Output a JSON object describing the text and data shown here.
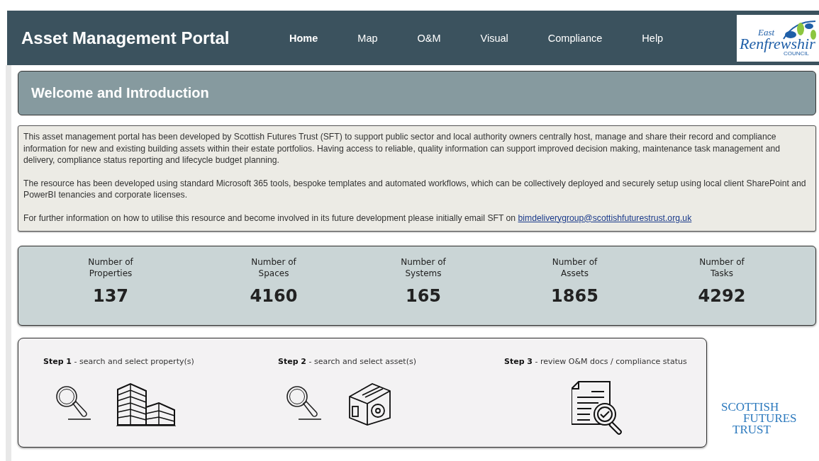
{
  "header": {
    "title": "Asset Management Portal",
    "nav": [
      {
        "label": "Home",
        "selected": true
      },
      {
        "label": "Map",
        "selected": false
      },
      {
        "label": "O&M",
        "selected": false
      },
      {
        "label": "Visual",
        "selected": false
      },
      {
        "label": "Compliance",
        "selected": false
      },
      {
        "label": "Help",
        "selected": false
      }
    ],
    "council_logo": {
      "line_1": "East",
      "line_2": "Renfrewshir",
      "line_3": "COUNCIL"
    }
  },
  "welcome": {
    "title": "Welcome and Introduction"
  },
  "intro": {
    "paragraphs": [
      {
        "text": "This asset management portal has been developed by Scottish Futures Trust (SFT) to support public sector and local authority owners centrally host, manage and share their record and compliance information for new and existing building assets within their estate portfolios. Having access to reliable, quality information can support improved decision making, maintenance task management and delivery, compliance status reporting and lifecycle budget planning."
      },
      {
        "text": "The resource has been developed using standard Microsoft 365 tools, bespoke templates and automated workflows, which can be collectively deployed and securely setup using local client SharePoint and PowerBI tenancies and corporate licenses."
      },
      {
        "text": "For further information on how to utilise this resource and become involved in its future development please initially email SFT on",
        "link": "bimdeliverygroup@scottishfuturestrust.org.uk"
      }
    ]
  },
  "stats": [
    {
      "label_1": "Number of",
      "label_2": "Properties",
      "value": "137"
    },
    {
      "label_1": "Number of",
      "label_2": "Spaces",
      "value": "4160"
    },
    {
      "label_1": "Number of",
      "label_2": "Systems",
      "value": "165"
    },
    {
      "label_1": "Number of",
      "label_2": "Assets",
      "value": "1865"
    },
    {
      "label_1": "Number of",
      "label_2": "Tasks",
      "value": "4292"
    }
  ],
  "steps": [
    {
      "step": "Step 1",
      "text": "- search and select property(s)",
      "kind": "property"
    },
    {
      "step": "Step 2",
      "text": "- search and select asset(s)",
      "kind": "asset"
    },
    {
      "step": "Step 3",
      "text": "- review O&M docs / compliance status",
      "kind": "review"
    }
  ],
  "sft_logo": [
    "SCOTTISH",
    "FUTURES",
    "TRUST"
  ]
}
